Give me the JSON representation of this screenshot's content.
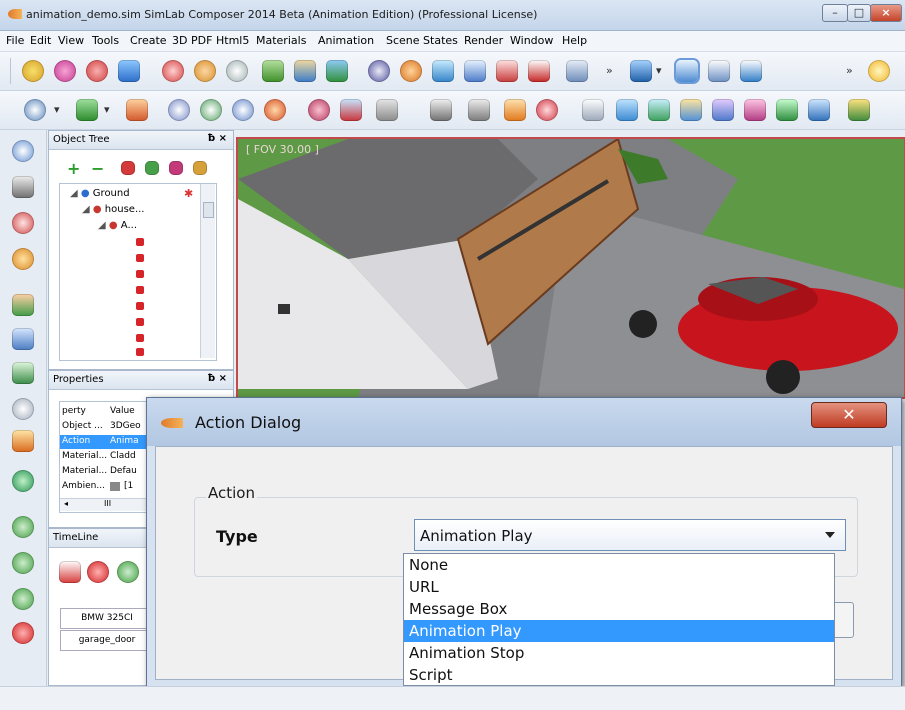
{
  "window": {
    "title": "animation_demo.sim SimLab Composer 2014 Beta (Animation Edition)  (Professional License)",
    "minimize": "–",
    "maximize": "□",
    "close": "×"
  },
  "menu": [
    "File",
    "Edit",
    "View",
    "Tools",
    "Create",
    "3D PDF",
    "Html5",
    "Materials",
    "Animation",
    "Scene States",
    "Render",
    "Window",
    "Help"
  ],
  "toolbar_more": "»",
  "object_tree": {
    "title": "Object Tree",
    "close": "ƀ ×",
    "add": "+",
    "remove": "−",
    "nodes": [
      "Ground",
      "house...",
      "A..."
    ]
  },
  "properties": {
    "title": "Properties",
    "close": "ƀ ×",
    "col_property": "perty",
    "col_value": "Value",
    "rows": [
      {
        "name": "Object ...",
        "value": "3DGeo"
      },
      {
        "name": "Action",
        "value": "Anima"
      },
      {
        "name": "Material...",
        "value": "Cladd"
      },
      {
        "name": "Material...",
        "value": "Defau"
      },
      {
        "name": "Ambien...",
        "value": "[1"
      }
    ],
    "scroll_label": "III"
  },
  "timeline": {
    "title": "TimeLine",
    "tracks": [
      "BMW 325CI",
      "garage_door"
    ]
  },
  "viewport": {
    "fov_label": "[ FOV 30.00 ]"
  },
  "dialog": {
    "title": "Action Dialog",
    "close": "✕",
    "group_label": "Action",
    "type_label": "Type",
    "selected": "Animation Play",
    "options": [
      "None",
      "URL",
      "Message Box",
      "Animation Play",
      "Animation Stop",
      "Script"
    ]
  },
  "colors": {
    "selection": "#3399ff",
    "viewport_border": "#c24a4a",
    "car": "#c8141c",
    "grass": "#5e9a45"
  }
}
